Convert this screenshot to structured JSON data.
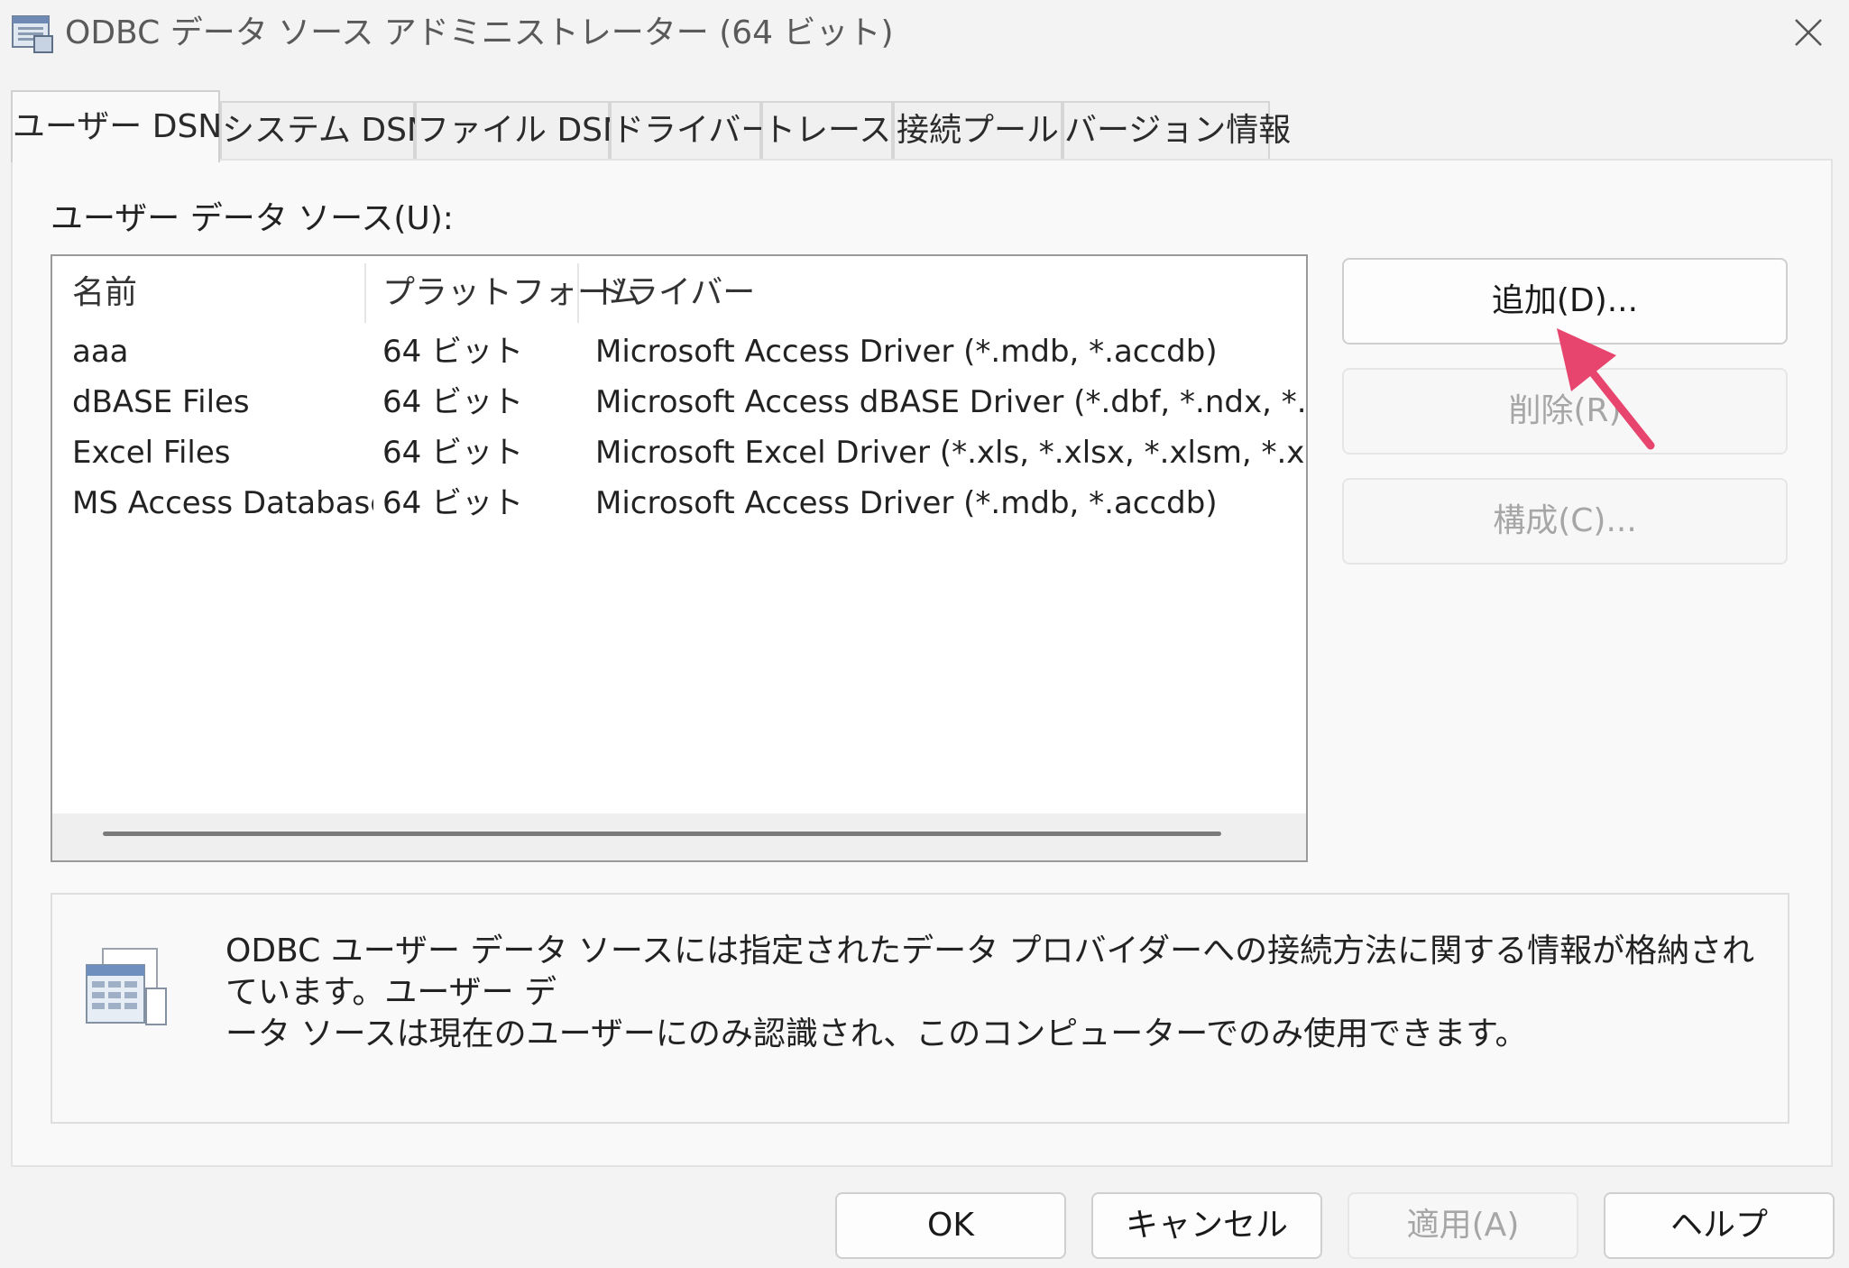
{
  "window": {
    "title": "ODBC データ ソース アドミニストレーター (64 ビット)",
    "close_glyph": "✕"
  },
  "tabs": [
    {
      "label": "ユーザー DSN",
      "active": true
    },
    {
      "label": "システム DSN",
      "active": false
    },
    {
      "label": "ファイル DSN",
      "active": false
    },
    {
      "label": "ドライバー",
      "active": false
    },
    {
      "label": "トレース",
      "active": false
    },
    {
      "label": "接続プール",
      "active": false
    },
    {
      "label": "バージョン情報",
      "active": false
    }
  ],
  "data_sources": {
    "label": "ユーザー データ ソース(U):",
    "columns": [
      "名前",
      "プラットフォーム",
      "ドライバー"
    ],
    "rows": [
      {
        "name": "aaa",
        "platform": "64 ビット",
        "driver": "Microsoft Access Driver (*.mdb, *.accdb)"
      },
      {
        "name": "dBASE Files",
        "platform": "64 ビット",
        "driver": "Microsoft Access dBASE Driver (*.dbf, *.ndx, *.mdx"
      },
      {
        "name": "Excel Files",
        "platform": "64 ビット",
        "driver": "Microsoft Excel Driver (*.xls, *.xlsx, *.xlsm, *.xlsb)"
      },
      {
        "name": "MS Access Database",
        "platform": "64 ビット",
        "driver": "Microsoft Access Driver (*.mdb, *.accdb)"
      }
    ]
  },
  "side_buttons": {
    "add": "追加(D)...",
    "remove": "削除(R)",
    "configure": "構成(C)..."
  },
  "description": {
    "line1": "ODBC ユーザー データ ソースには指定されたデータ プロバイダーへの接続方法に関する情報が格納されています。ユーザー デ",
    "line2": "ータ ソースは現在のユーザーにのみ認識され、このコンピューターでのみ使用できます。"
  },
  "bottom_buttons": {
    "ok": "OK",
    "cancel": "キャンセル",
    "apply": "適用(A)",
    "help": "ヘルプ"
  },
  "colors": {
    "annotation_arrow": "#e8456e",
    "disabled_text": "#a6a6a6"
  }
}
